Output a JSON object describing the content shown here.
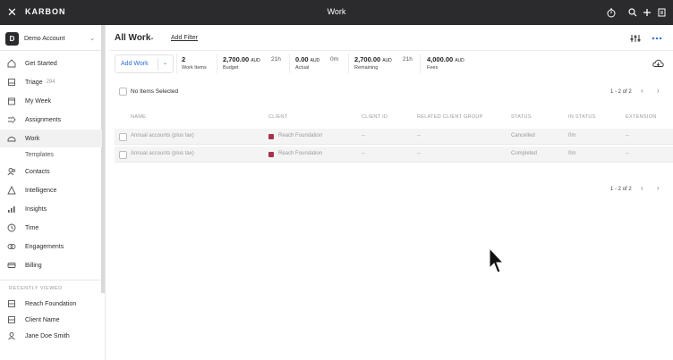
{
  "topbar": {
    "brand": "KARBON",
    "title": "Work",
    "icons": [
      "close-icon",
      "timer-icon",
      "search-icon",
      "plus-icon",
      "notes-icon"
    ]
  },
  "sidebar": {
    "account": {
      "initial": "D",
      "name": "Demo Account"
    },
    "items": [
      {
        "label": "Get Started",
        "icon": "rocket-icon"
      },
      {
        "label": "Triage",
        "count": "294",
        "icon": "inbox-icon"
      },
      {
        "label": "My Week",
        "icon": "calendar-icon"
      },
      {
        "label": "Assignments",
        "icon": "assignments-icon"
      },
      {
        "label": "Work",
        "icon": "work-icon",
        "active": true
      },
      {
        "label": "Templates",
        "sub": true
      },
      {
        "label": "Contacts",
        "icon": "contacts-icon"
      },
      {
        "label": "Intelligence",
        "icon": "intelligence-icon"
      },
      {
        "label": "Insights",
        "icon": "insights-icon"
      },
      {
        "label": "Time",
        "icon": "clock-icon"
      },
      {
        "label": "Engagements",
        "icon": "engagements-icon"
      },
      {
        "label": "Billing",
        "icon": "billing-icon"
      }
    ],
    "recently_viewed_label": "RECENTLY VIEWED",
    "recent": [
      {
        "label": "Reach Foundation",
        "icon": "organization-icon"
      },
      {
        "label": "Client Name",
        "icon": "organization-icon"
      },
      {
        "label": "Jane Doe Smith",
        "icon": "person-icon"
      }
    ]
  },
  "main": {
    "title": "All Work",
    "add_filter": "Add Filter",
    "add_work": "Add Work",
    "stats": {
      "work_items": {
        "value": "2",
        "label": "Work Items"
      },
      "budget": {
        "value": "2,700.00",
        "unit": "AUD",
        "label": "Budget",
        "time": "21h"
      },
      "actual": {
        "value": "0.00",
        "unit": "AUD",
        "label": "Actual",
        "time": "0m"
      },
      "remaining": {
        "value": "2,700.00",
        "unit": "AUD",
        "label": "Remaining",
        "time": "21h"
      },
      "fees": {
        "value": "4,000.00",
        "unit": "AUD",
        "label": "Fees"
      }
    },
    "selection": "No Items Selected",
    "pagination": "1 - 2 of 2",
    "columns": [
      "NAME",
      "CLIENT",
      "CLIENT ID",
      "RELATED CLIENT GROUP",
      "STATUS",
      "IN STATUS",
      "EXTENSION"
    ],
    "rows": [
      {
        "name": "Annual accounts (plus tax)",
        "client": "Reach Foundation",
        "client_id": "--",
        "group": "--",
        "status": "Cancelled",
        "in_status": "0m",
        "extension": "--"
      },
      {
        "name": "Annual accounts (plus tax)",
        "client": "Reach Foundation",
        "client_id": "--",
        "group": "--",
        "status": "Completed",
        "in_status": "0m",
        "extension": "--"
      }
    ],
    "colors": {
      "accent": "#2d6ed8",
      "client_badge": "#a8324a",
      "topbar": "#2b2b2e"
    }
  }
}
